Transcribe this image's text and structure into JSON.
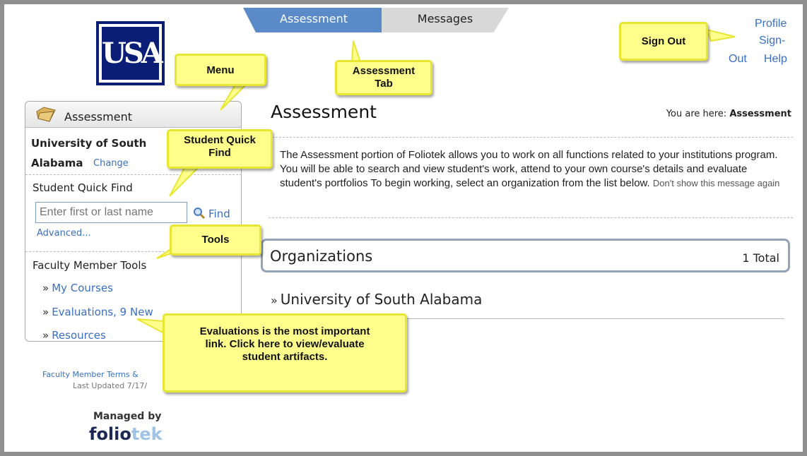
{
  "tabs": {
    "assessment": "Assessment",
    "messages": "Messages"
  },
  "top_links": {
    "profile": "Profile",
    "sign": "Sign-",
    "out": "Out",
    "help": "Help"
  },
  "logo": {
    "text": "USA"
  },
  "sidebar": {
    "title": "Assessment",
    "institution_line1": "University of South",
    "institution_line2": "Alabama",
    "change": "Change",
    "quick_find_label": "Student Quick Find",
    "quick_find_placeholder": "Enter first or last name",
    "find": "Find",
    "advanced": "Advanced...",
    "tools_label": "Faculty Member Tools",
    "tools": [
      "My Courses",
      "Evaluations, 9 New",
      "Resources"
    ]
  },
  "main": {
    "title": "Assessment",
    "breadcrumb_prefix": "You are here:",
    "breadcrumb_current": "Assessment",
    "intro": "The Assessment portion of Foliotek allows you to work on all functions related to your institutions program. You will be able to search and view student's work, attend to your own course's details and evaluate student's portfolios To begin working, select an organization from the list below.",
    "intro_dismiss": "Don't show this message again",
    "organizations_title": "Organizations",
    "organizations_total": "1 Total",
    "organizations": [
      "University of South Alabama"
    ]
  },
  "footer": {
    "terms": "Faculty Member Terms &",
    "updated": "Last Updated 7/17/",
    "managed_by": "Managed by",
    "brand_part1": "folio",
    "brand_part2": "tek"
  },
  "callouts": {
    "sign_out": "Sign Out",
    "menu": "Menu",
    "assessment_tab_1": "Assessment",
    "assessment_tab_2": "Tab",
    "student_quick_find_1": "Student Quick",
    "student_quick_find_2": "Find",
    "tools": "Tools",
    "evaluations_1": "Evaluations is the most important",
    "evaluations_2": "link. Click here to view/evaluate",
    "evaluations_3": "student artifacts."
  },
  "colors": {
    "tab_active": "#5b8ac9",
    "link": "#3a6fc1",
    "callout_fill": "#ffff8c",
    "logo_navy": "#0a1d77"
  }
}
